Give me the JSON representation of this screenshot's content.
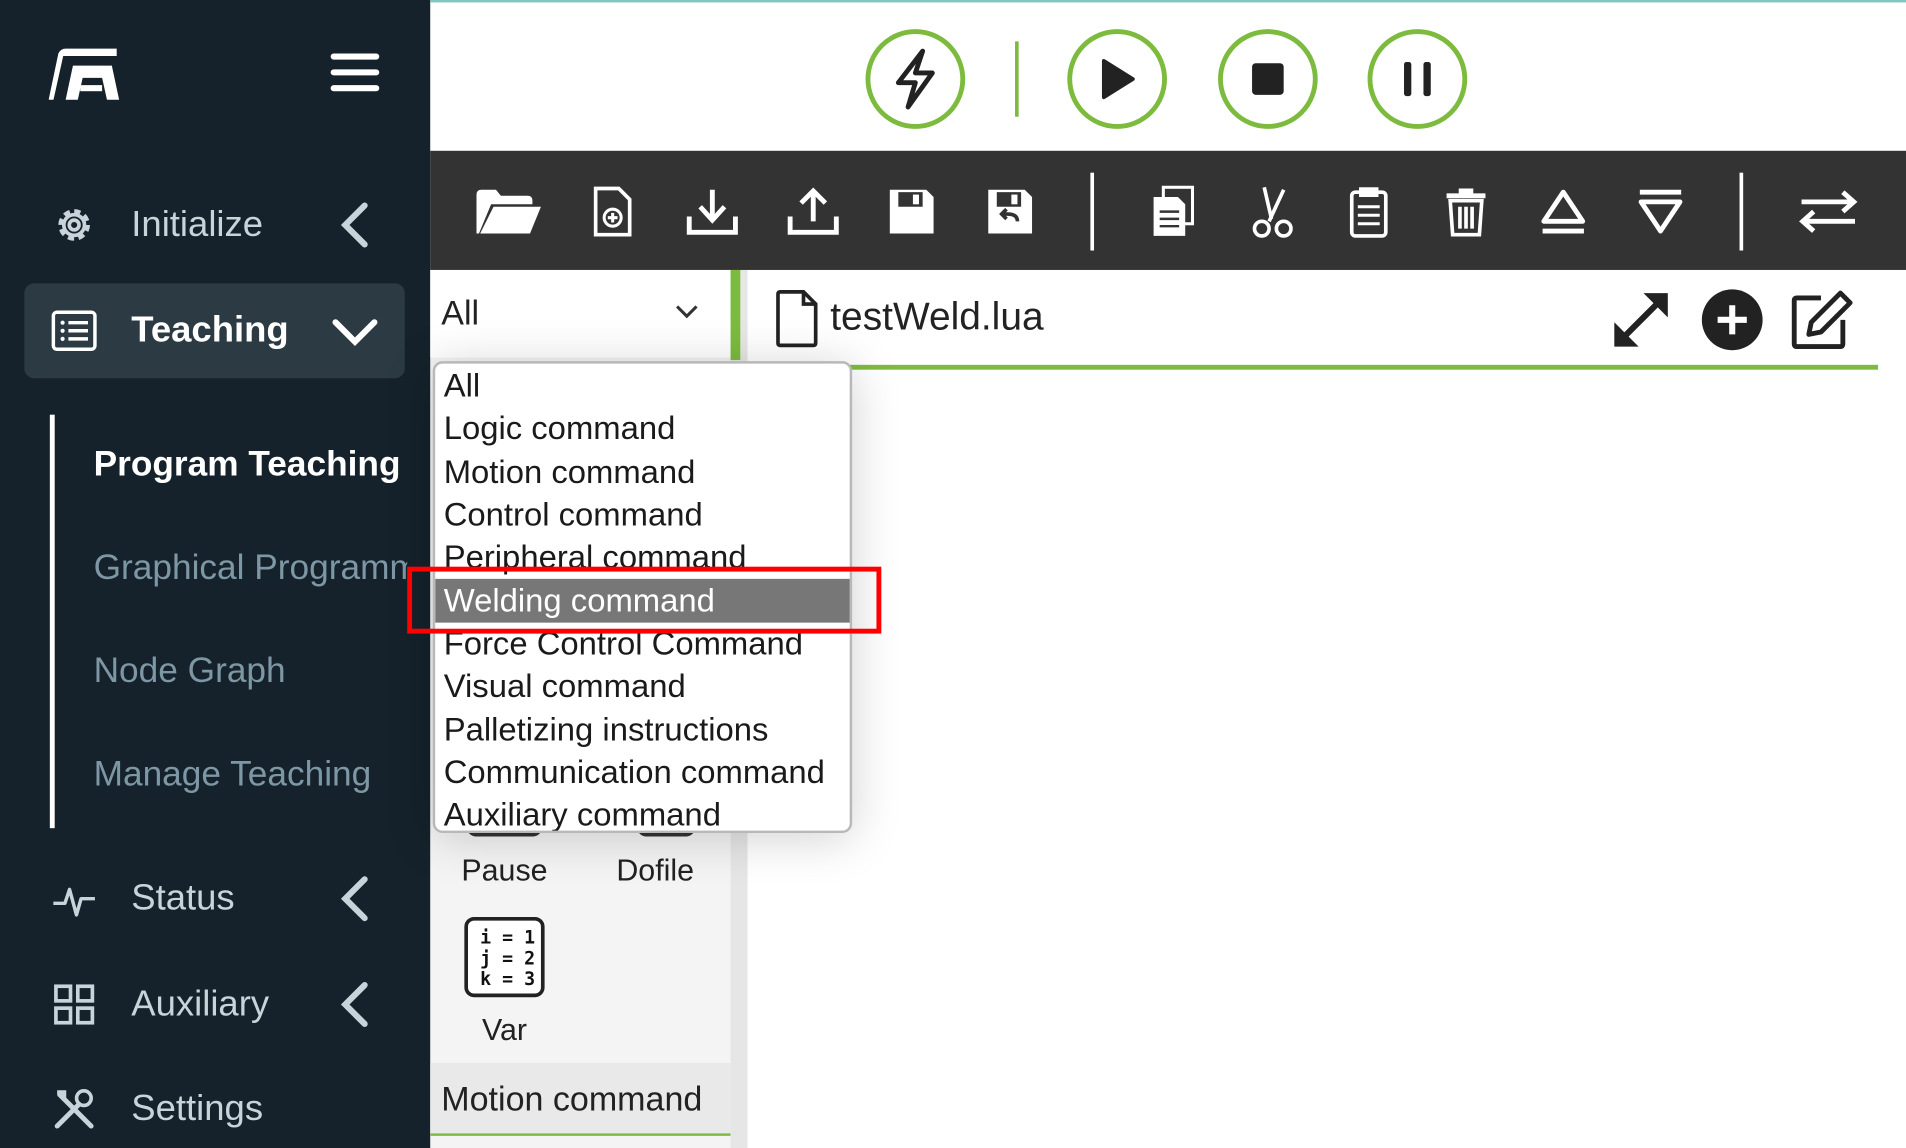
{
  "sidebar": {
    "nav": [
      {
        "label": "Initialize",
        "icon": "gear-icon"
      },
      {
        "label": "Teaching",
        "icon": "list-icon"
      },
      {
        "label": "Status",
        "icon": "pulse-icon"
      },
      {
        "label": "Auxiliary",
        "icon": "grid-icon"
      },
      {
        "label": "Settings",
        "icon": "tools-icon"
      }
    ],
    "teaching_sub": [
      {
        "label": "Program Teaching"
      },
      {
        "label": "Graphical Programming"
      },
      {
        "label": "Node Graph"
      },
      {
        "label": "Manage Teaching"
      }
    ]
  },
  "controls": [
    "enable-icon",
    "run-icon",
    "stop-icon",
    "pause-icon"
  ],
  "toolbar": [
    "open-folder-icon",
    "new-file-icon",
    "import-icon",
    "export-icon",
    "save-icon",
    "save-as-icon",
    "copy-icon",
    "cut-icon",
    "paste-icon",
    "delete-icon",
    "move-up-icon",
    "move-down-icon",
    "switch-icon"
  ],
  "command_panel": {
    "filter_value": "All",
    "commands": [
      {
        "label": "Pause"
      },
      {
        "label": "Dofile"
      },
      {
        "label": "Var",
        "icon_lines": [
          "i = 1",
          "j = 2",
          "k = 3"
        ]
      }
    ],
    "section": "Motion command"
  },
  "editor": {
    "file_name": "testWeld.lua"
  },
  "dropdown": {
    "options": [
      "All",
      "Logic command",
      "Motion command",
      "Control command",
      "Peripheral command",
      "Welding command",
      "Force Control Command",
      "Visual command",
      "Palletizing instructions",
      "Communication command",
      "Auxiliary command"
    ],
    "selected": "Welding command"
  },
  "colors": {
    "sidebar_bg": "#15222b",
    "accent_green": "#7dbb3e",
    "toolbar_bg": "#333333",
    "selected_option": "#777777",
    "highlight_red": "#ff0000"
  }
}
